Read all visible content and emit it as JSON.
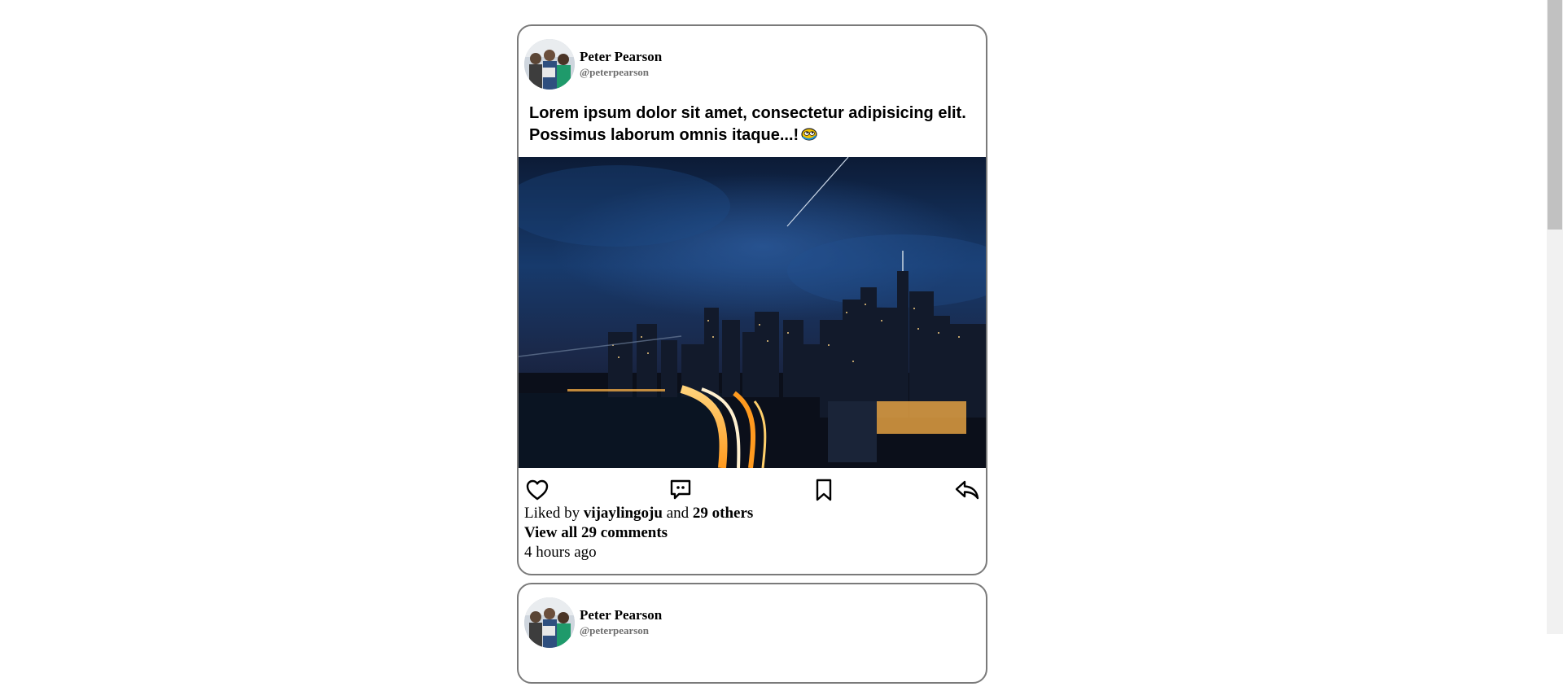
{
  "posts": [
    {
      "author_name": "Peter Pearson",
      "author_handle": "@peterpearson",
      "caption": "Lorem ipsum dolor sit amet, consectetur adipisicing elit. Possimus laborum omnis itaque...!",
      "caption_emoji": "rolling-eyes-emoji",
      "photo": "night-city-skyline",
      "actions": [
        "heart-icon",
        "comment-icon",
        "bookmark-icon",
        "share-icon"
      ],
      "likes_prefix": "Liked by",
      "liked_by_user": "vijaylingoju",
      "likes_and": "and",
      "likes_others": "29 others",
      "comments_link": "View all 29 comments",
      "timestamp": "4 hours ago"
    },
    {
      "author_name": "Peter Pearson",
      "author_handle": "@peterpearson"
    }
  ]
}
